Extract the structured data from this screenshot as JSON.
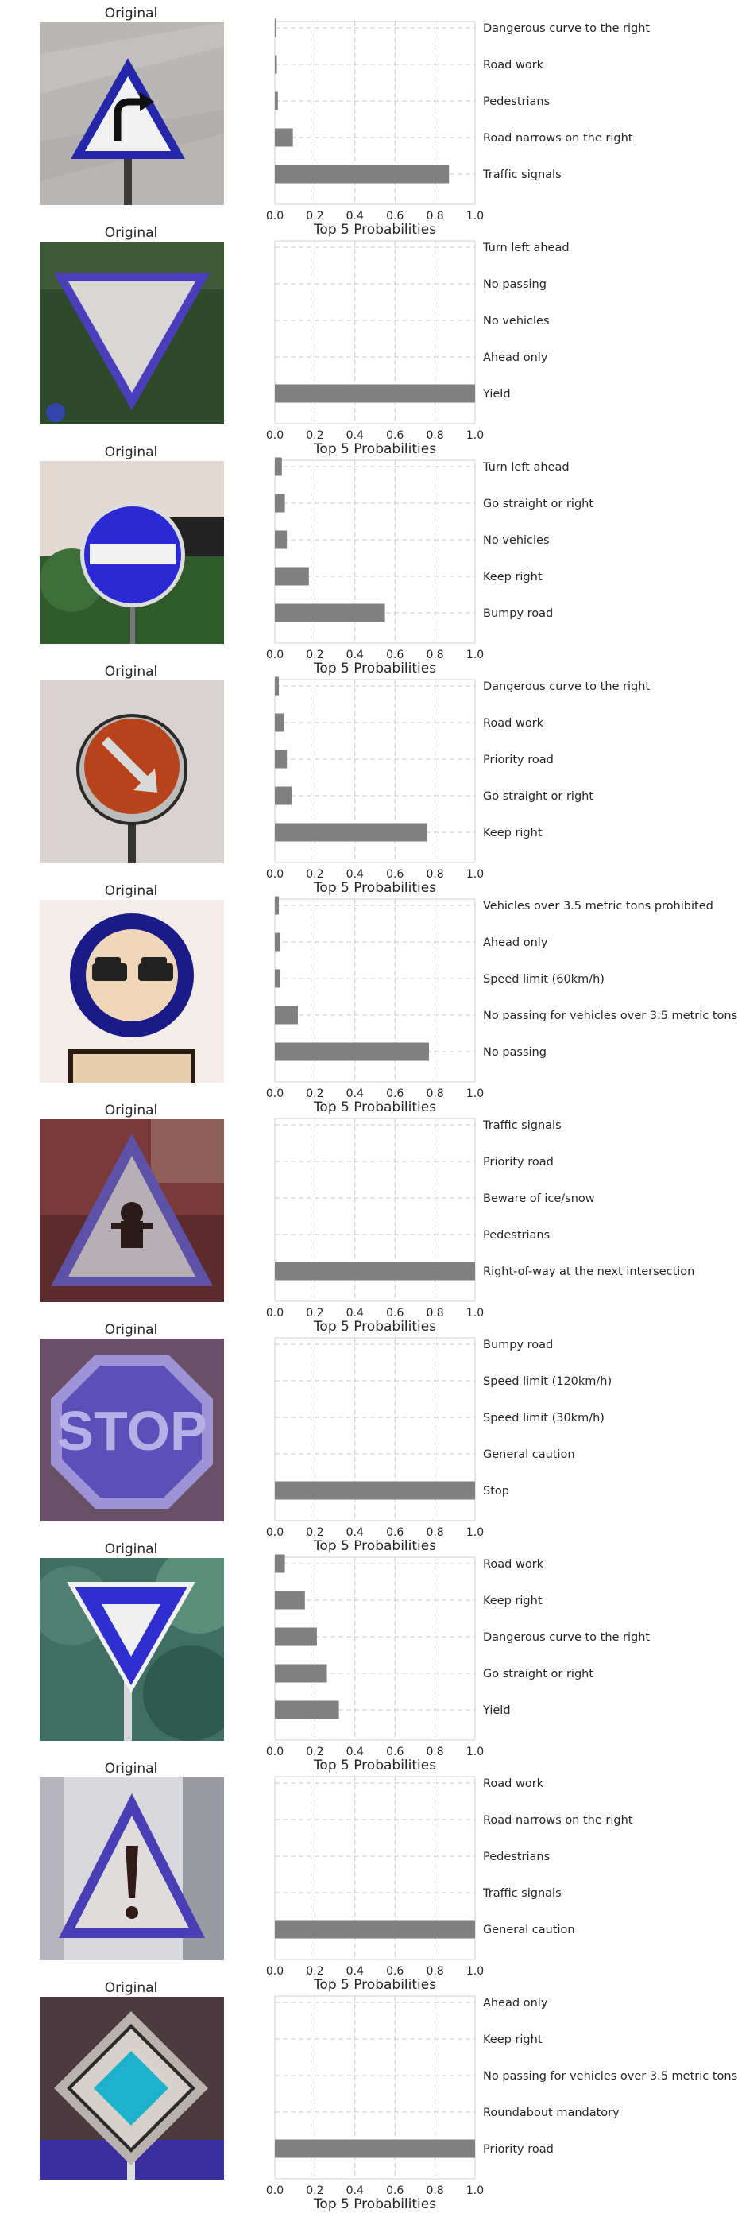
{
  "image_title": "Original",
  "colors": {
    "bar": "#808080",
    "grid": "#c8c8c8",
    "frame": "#cfcfcf"
  },
  "chart_data": [
    {
      "type": "bar",
      "orientation": "horizontal",
      "sign_icon": "turn-right-ahead-sign",
      "categories": [
        "Traffic signals",
        "Road narrows on the right",
        "Pedestrians",
        "Road work",
        "Dangerous curve to the right"
      ],
      "values": [
        0.87,
        0.09,
        0.015,
        0.01,
        0.008
      ],
      "xlabel": "Top 5 Probabilities",
      "xlim": [
        0,
        1
      ],
      "xticks": [
        "0.0",
        "0.2",
        "0.4",
        "0.6",
        "0.8",
        "1.0"
      ],
      "grid": true
    },
    {
      "type": "bar",
      "orientation": "horizontal",
      "sign_icon": "yield-sign",
      "categories": [
        "Yield",
        "Ahead only",
        "No vehicles",
        "No passing",
        "Turn left ahead"
      ],
      "values": [
        1.0,
        0.0,
        0.0,
        0.0,
        0.0
      ],
      "xlabel": "Top 5 Probabilities",
      "xlim": [
        0,
        1
      ],
      "xticks": [
        "0.0",
        "0.2",
        "0.4",
        "0.6",
        "0.8",
        "1.0"
      ],
      "grid": true
    },
    {
      "type": "bar",
      "orientation": "horizontal",
      "sign_icon": "no-entry-sign",
      "categories": [
        "Bumpy road",
        "Keep right",
        "No vehicles",
        "Go straight or right",
        "Turn left ahead"
      ],
      "values": [
        0.55,
        0.17,
        0.06,
        0.05,
        0.035
      ],
      "xlabel": "Top 5 Probabilities",
      "xlim": [
        0,
        1
      ],
      "xticks": [
        "0.0",
        "0.2",
        "0.4",
        "0.6",
        "0.8",
        "1.0"
      ],
      "grid": true
    },
    {
      "type": "bar",
      "orientation": "horizontal",
      "sign_icon": "keep-right-sign",
      "categories": [
        "Keep right",
        "Go straight or right",
        "Priority road",
        "Road work",
        "Dangerous curve to the right"
      ],
      "values": [
        0.76,
        0.085,
        0.06,
        0.045,
        0.02
      ],
      "xlabel": "Top 5 Probabilities",
      "xlim": [
        0,
        1
      ],
      "xticks": [
        "0.0",
        "0.2",
        "0.4",
        "0.6",
        "0.8",
        "1.0"
      ],
      "grid": true
    },
    {
      "type": "bar",
      "orientation": "horizontal",
      "sign_icon": "no-passing-sign",
      "categories": [
        "No passing",
        "No passing for vehicles over 3.5 metric tons",
        "Speed limit (60km/h)",
        "Ahead only",
        "Vehicles over 3.5 metric tons prohibited"
      ],
      "values": [
        0.77,
        0.115,
        0.025,
        0.025,
        0.02
      ],
      "xlabel": "Top 5 Probabilities",
      "xlim": [
        0,
        1
      ],
      "xticks": [
        "0.0",
        "0.2",
        "0.4",
        "0.6",
        "0.8",
        "1.0"
      ],
      "grid": true
    },
    {
      "type": "bar",
      "orientation": "horizontal",
      "sign_icon": "right-of-way-sign",
      "categories": [
        "Right-of-way at the next intersection",
        "Pedestrians",
        "Beware of ice/snow",
        "Priority road",
        "Traffic signals"
      ],
      "values": [
        1.0,
        0.0,
        0.0,
        0.0,
        0.0
      ],
      "xlabel": "Top 5 Probabilities",
      "xlim": [
        0,
        1
      ],
      "xticks": [
        "0.0",
        "0.2",
        "0.4",
        "0.6",
        "0.8",
        "1.0"
      ],
      "grid": true
    },
    {
      "type": "bar",
      "orientation": "horizontal",
      "sign_icon": "stop-sign",
      "categories": [
        "Stop",
        "General caution",
        "Speed limit (30km/h)",
        "Speed limit (120km/h)",
        "Bumpy road"
      ],
      "values": [
        1.0,
        0.0,
        0.0,
        0.0,
        0.0
      ],
      "xlabel": "Top 5 Probabilities",
      "xlim": [
        0,
        1
      ],
      "xticks": [
        "0.0",
        "0.2",
        "0.4",
        "0.6",
        "0.8",
        "1.0"
      ],
      "grid": true
    },
    {
      "type": "bar",
      "orientation": "horizontal",
      "sign_icon": "yield-sign-photo",
      "categories": [
        "Yield",
        "Go straight or right",
        "Dangerous curve to the right",
        "Keep right",
        "Road work"
      ],
      "values": [
        0.32,
        0.26,
        0.21,
        0.15,
        0.05
      ],
      "xlabel": "Top 5 Probabilities",
      "xlim": [
        0,
        1
      ],
      "xticks": [
        "0.0",
        "0.2",
        "0.4",
        "0.6",
        "0.8",
        "1.0"
      ],
      "grid": true
    },
    {
      "type": "bar",
      "orientation": "horizontal",
      "sign_icon": "general-caution-sign",
      "categories": [
        "General caution",
        "Traffic signals",
        "Pedestrians",
        "Road narrows on the right",
        "Road work"
      ],
      "values": [
        1.0,
        0.0,
        0.0,
        0.0,
        0.0
      ],
      "xlabel": "Top 5 Probabilities",
      "xlim": [
        0,
        1
      ],
      "xticks": [
        "0.0",
        "0.2",
        "0.4",
        "0.6",
        "0.8",
        "1.0"
      ],
      "grid": true
    },
    {
      "type": "bar",
      "orientation": "horizontal",
      "sign_icon": "priority-road-sign",
      "categories": [
        "Priority road",
        "Roundabout mandatory",
        "No passing for vehicles over 3.5 metric tons",
        "Keep right",
        "Ahead only"
      ],
      "values": [
        1.0,
        0.0,
        0.0,
        0.0,
        0.0
      ],
      "xlabel": "Top 5 Probabilities",
      "xlim": [
        0,
        1
      ],
      "xticks": [
        "0.0",
        "0.2",
        "0.4",
        "0.6",
        "0.8",
        "1.0"
      ],
      "grid": true
    }
  ]
}
